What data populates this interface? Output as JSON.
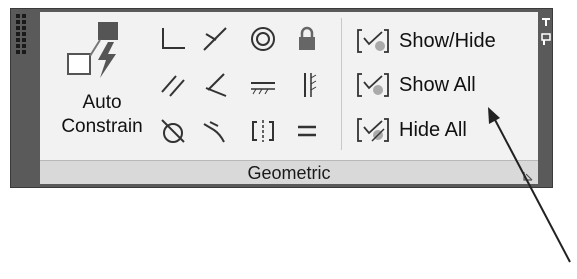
{
  "panel": {
    "title": "Geometric",
    "auto_constrain": {
      "line1": "Auto",
      "line2": "Constrain"
    },
    "visibility": [
      {
        "label": "Show/Hide"
      },
      {
        "label": "Show All"
      },
      {
        "label": "Hide All"
      }
    ],
    "tools": [
      "coincident-icon",
      "collinear-icon",
      "concentric-icon",
      "fix-icon",
      "parallel-icon",
      "perpendicular-icon",
      "horizontal-icon",
      "vertical-icon",
      "tangent-icon",
      "smooth-icon",
      "symmetric-icon",
      "equal-icon"
    ]
  }
}
